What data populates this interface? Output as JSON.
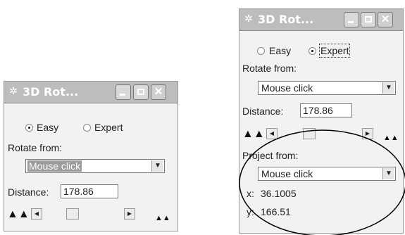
{
  "left_dialog": {
    "title": "3D Rot...",
    "mode_easy": "Easy",
    "mode_expert": "Expert",
    "rotate_from_label": "Rotate from:",
    "rotate_from_value": "Mouse click",
    "distance_label": "Distance:",
    "distance_value": "178.86"
  },
  "right_dialog": {
    "title": "3D Rot...",
    "mode_easy": "Easy",
    "mode_expert": "Expert",
    "rotate_from_label": "Rotate from:",
    "rotate_from_value": "Mouse click",
    "distance_label": "Distance:",
    "distance_value": "178.86",
    "project_from_label": "Project from:",
    "project_from_value": "Mouse click",
    "x_label": "x:",
    "x_value": "36.1005",
    "y_label": "y:",
    "y_value": "166.51"
  }
}
